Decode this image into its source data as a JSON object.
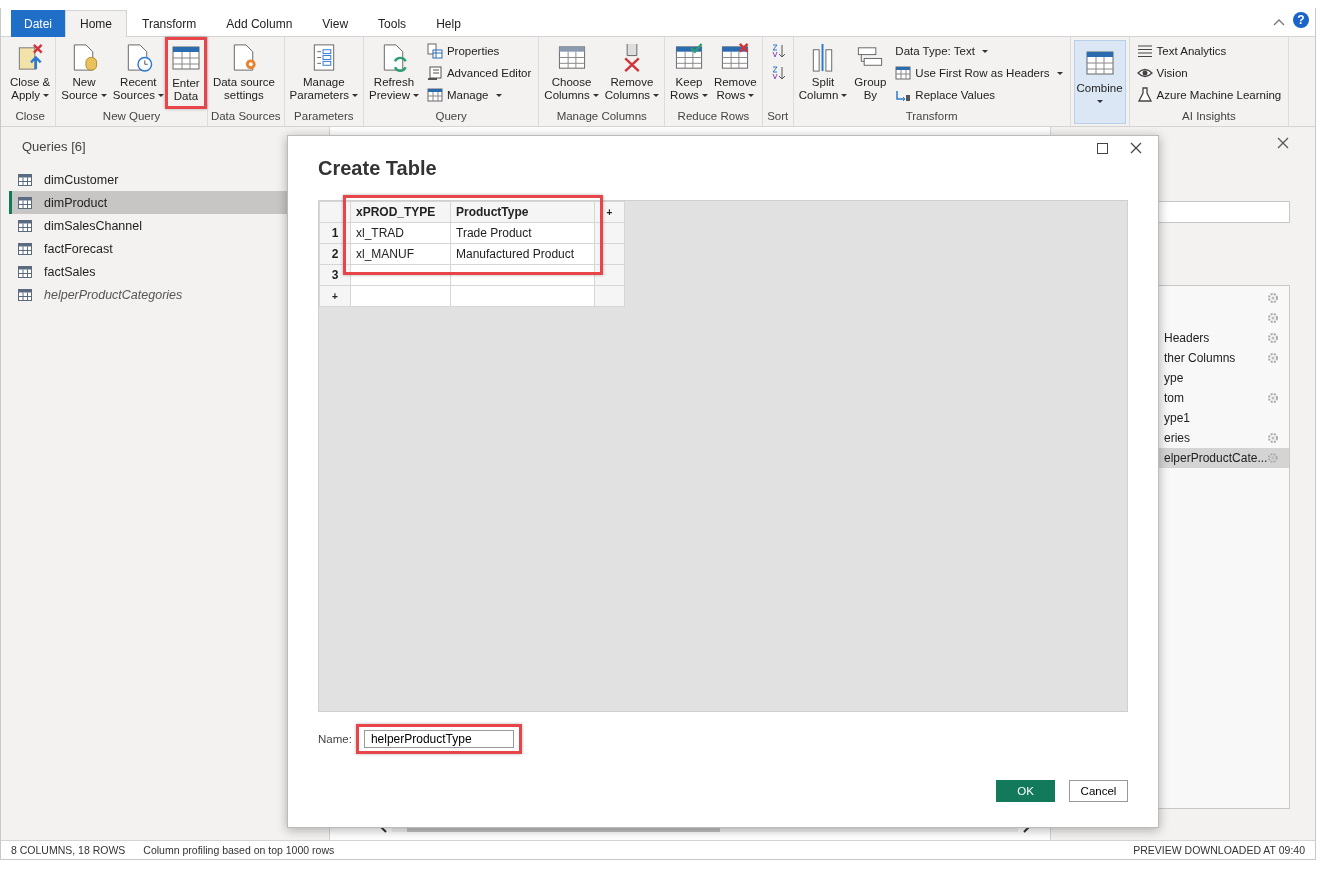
{
  "tabs": [
    {
      "label": "Datei",
      "kind": "file",
      "selected": false
    },
    {
      "label": "Home",
      "kind": "tab",
      "selected": true
    },
    {
      "label": "Transform",
      "kind": "tab",
      "selected": false
    },
    {
      "label": "Add Column",
      "kind": "tab",
      "selected": false
    },
    {
      "label": "View",
      "kind": "tab",
      "selected": false
    },
    {
      "label": "Tools",
      "kind": "tab",
      "selected": false
    },
    {
      "label": "Help",
      "kind": "tab",
      "selected": false
    }
  ],
  "help_button": "?",
  "ribbon": [
    {
      "label": "Close",
      "columns": [
        {
          "kind": "large",
          "lines": [
            "Close &",
            "Apply"
          ],
          "dropdown": true,
          "highlighted": false,
          "pressed": false
        }
      ]
    },
    {
      "label": "New Query",
      "columns": [
        {
          "kind": "large",
          "lines": [
            "New",
            "Source"
          ],
          "dropdown": true,
          "highlighted": false,
          "pressed": false
        },
        {
          "kind": "large",
          "lines": [
            "Recent",
            "Sources"
          ],
          "dropdown": true,
          "highlighted": false,
          "pressed": false
        },
        {
          "kind": "large",
          "lines": [
            "Enter",
            "Data"
          ],
          "dropdown": false,
          "highlighted": true,
          "pressed": false
        }
      ]
    },
    {
      "label": "Data Sources",
      "columns": [
        {
          "kind": "large",
          "lines": [
            "Data source",
            "settings"
          ],
          "dropdown": false,
          "highlighted": false,
          "pressed": false
        }
      ]
    },
    {
      "label": "Parameters",
      "columns": [
        {
          "kind": "large",
          "lines": [
            "Manage",
            "Parameters"
          ],
          "dropdown": true,
          "highlighted": false,
          "pressed": false
        }
      ]
    },
    {
      "label": "Query",
      "columns": [
        {
          "kind": "large",
          "lines": [
            "Refresh",
            "Preview"
          ],
          "dropdown": true,
          "highlighted": false,
          "pressed": false
        },
        {
          "kind": "stack",
          "items": [
            {
              "label": "Properties",
              "dropdown": false
            },
            {
              "label": "Advanced Editor",
              "dropdown": false
            },
            {
              "label": "Manage",
              "dropdown": true
            }
          ]
        }
      ]
    },
    {
      "label": "Manage Columns",
      "columns": [
        {
          "kind": "large",
          "lines": [
            "Choose",
            "Columns"
          ],
          "dropdown": true,
          "highlighted": false,
          "pressed": false
        },
        {
          "kind": "large",
          "lines": [
            "Remove",
            "Columns"
          ],
          "dropdown": true,
          "highlighted": false,
          "pressed": false
        }
      ]
    },
    {
      "label": "Reduce Rows",
      "columns": [
        {
          "kind": "large",
          "lines": [
            "Keep",
            "Rows"
          ],
          "dropdown": true,
          "highlighted": false,
          "pressed": false
        },
        {
          "kind": "large",
          "lines": [
            "Remove",
            "Rows"
          ],
          "dropdown": true,
          "highlighted": false,
          "pressed": false
        }
      ]
    },
    {
      "label": "Sort",
      "columns": [
        {
          "kind": "stack",
          "items": [
            {
              "dropdown": false
            },
            {
              "dropdown": false
            }
          ]
        }
      ]
    },
    {
      "label": "Transform",
      "columns": [
        {
          "kind": "large",
          "lines": [
            "Split",
            "Column"
          ],
          "dropdown": true,
          "highlighted": false,
          "pressed": false
        },
        {
          "kind": "large",
          "lines": [
            "Group",
            "By"
          ],
          "dropdown": false,
          "highlighted": false,
          "pressed": false
        },
        {
          "kind": "stack",
          "items": [
            {
              "label": "Data Type: Text",
              "dropdown": true
            },
            {
              "label": "Use First Row as Headers",
              "dropdown": true
            },
            {
              "label": "Replace Values",
              "dropdown": false
            }
          ]
        }
      ]
    },
    {
      "columns": [
        {
          "kind": "large",
          "lines": [
            "Combine"
          ],
          "dropdown": true,
          "highlighted": false,
          "pressed": true
        }
      ]
    },
    {
      "label": "AI Insights",
      "columns": [
        {
          "kind": "stack",
          "items": [
            {
              "label": "Text Analytics",
              "dropdown": false
            },
            {
              "label": "Vision",
              "dropdown": false
            },
            {
              "label": "Azure Machine Learning",
              "dropdown": false
            }
          ]
        }
      ]
    }
  ],
  "queries": {
    "title": "Queries [6]",
    "items": [
      {
        "name": "dimCustomer",
        "selected": false,
        "load_enabled": true
      },
      {
        "name": "dimProduct",
        "selected": true,
        "load_enabled": true
      },
      {
        "name": "dimSalesChannel",
        "selected": false,
        "load_enabled": true
      },
      {
        "name": "factForecast",
        "selected": false,
        "load_enabled": true
      },
      {
        "name": "factSales",
        "selected": false,
        "load_enabled": true
      },
      {
        "name": "helperProductCategories",
        "selected": false,
        "load_enabled": false
      }
    ]
  },
  "applied_steps": [
    {
      "has_settings": true,
      "selected": false
    },
    {
      "has_settings": true,
      "selected": false
    },
    {
      "label": "Headers",
      "has_settings": true,
      "selected": false
    },
    {
      "label": "ther Columns",
      "has_settings": true,
      "selected": false
    },
    {
      "label": "ype",
      "has_settings": false,
      "selected": false
    },
    {
      "label": "tom",
      "has_settings": true,
      "selected": false
    },
    {
      "label": "ype1",
      "has_settings": false,
      "selected": false
    },
    {
      "label": "eries",
      "has_settings": true,
      "selected": false
    },
    {
      "label": "elperProductCate...",
      "has_settings": true,
      "selected": true
    }
  ],
  "dialog": {
    "title": "Create Table",
    "grid": {
      "highlighted": true,
      "add_column": "+",
      "add_row": "+",
      "columns": [
        "xPROD_TYPE",
        "ProductType"
      ],
      "rows": [
        {
          "number": "1",
          "cells": [
            "xl_TRAD",
            "Trade Product"
          ]
        },
        {
          "number": "2",
          "cells": [
            "xl_MANUF",
            "Manufactured Product"
          ]
        },
        {
          "number": "3",
          "cells": []
        }
      ]
    },
    "name_label": "Name:",
    "name_value": "helperProductType",
    "name_highlighted": true,
    "buttons": [
      {
        "label": "OK",
        "kind": "primary"
      },
      {
        "label": "Cancel",
        "kind": "secondary"
      }
    ]
  },
  "status_bar": {
    "left": [
      "8 COLUMNS, 18 ROWS",
      "Column profiling based on top 1000 rows"
    ],
    "right": "PREVIEW DOWNLOADED AT 09:40"
  }
}
